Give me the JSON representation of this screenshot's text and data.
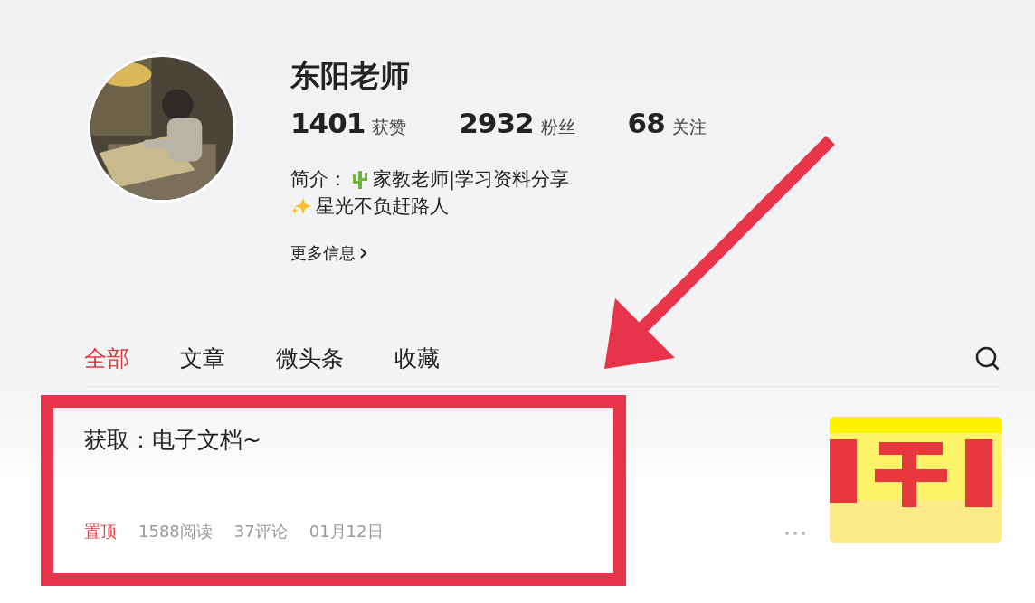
{
  "profile": {
    "name": "东阳老师",
    "stats": [
      {
        "value": "1401",
        "label": "获赞"
      },
      {
        "value": "2932",
        "label": "粉丝"
      },
      {
        "value": "68",
        "label": "关注"
      }
    ],
    "bio_label": "简介：",
    "bio_lines": [
      "家教老师|学习资料分享",
      "星光不负赶路人"
    ],
    "more_link": "更多信息"
  },
  "tabs": [
    {
      "label": "全部",
      "selected": true
    },
    {
      "label": "文章",
      "selected": false
    },
    {
      "label": "微头条",
      "selected": false
    },
    {
      "label": "收藏",
      "selected": false
    }
  ],
  "posts": [
    {
      "title": "获取：电子文档~",
      "pinned": true,
      "pin_label": "置顶",
      "reads": "1588阅读",
      "comments": "37评论",
      "date": "01月12日"
    }
  ]
}
